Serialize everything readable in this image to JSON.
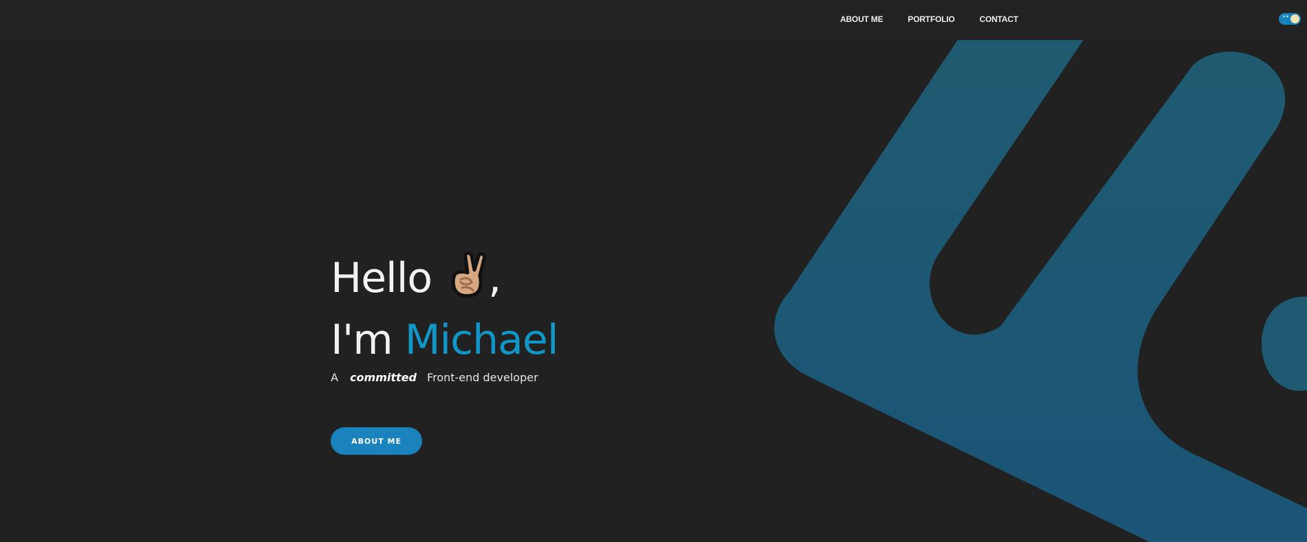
{
  "nav": {
    "items": [
      {
        "label": "ABOUT ME"
      },
      {
        "label": "PORTFOLIO"
      },
      {
        "label": "CONTACT"
      }
    ],
    "theme_toggle": {
      "state": "on",
      "icon": "moon-knob"
    }
  },
  "hero": {
    "greeting": "Hello",
    "greeting_icon": "victory-hand-icon",
    "greeting_suffix": ",",
    "intro_prefix": "I'm",
    "name": "Michael",
    "tagline": {
      "article": "A",
      "emphasis": "committed",
      "role": "Front-end developer"
    },
    "cta_label": "ABOUT ME"
  },
  "colors": {
    "background": "#212121",
    "accent": "#1196c8",
    "button": "#1a83be",
    "shape": "#1f5a72"
  }
}
